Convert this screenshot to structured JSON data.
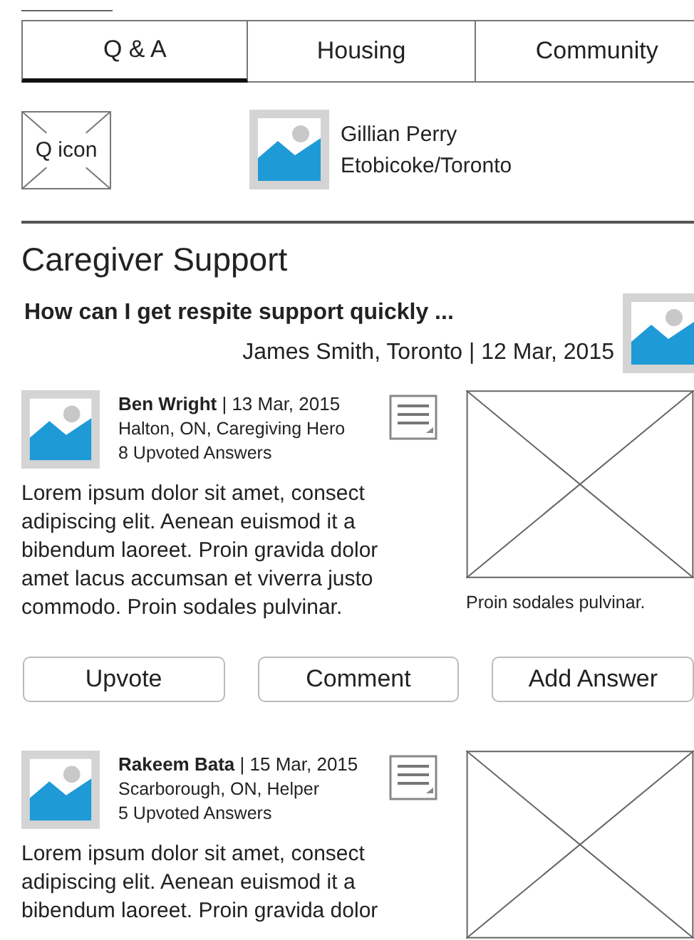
{
  "tabs": [
    {
      "label": "Q & A",
      "selected": true
    },
    {
      "label": "Housing",
      "selected": false
    },
    {
      "label": "Community",
      "selected": false
    }
  ],
  "profile": {
    "icon_label": "Q icon",
    "name": "Gillian Perry",
    "location": "Etobicoke/Toronto"
  },
  "section_title": "Caregiver Support",
  "question": {
    "title": "How can I get respite support quickly ...",
    "byline": "James Smith, Toronto | 12 Mar, 2015"
  },
  "answers": [
    {
      "author": "Ben Wright",
      "date": " | 13 Mar, 2015",
      "details": "Halton, ON, Caregiving Hero",
      "upvotes": "8 Upvoted Answers",
      "body": "Lorem ipsum dolor sit amet, consect adipiscing elit. Aenean euismod it a bibendum laoreet. Proin gravida dolor amet lacus accumsan et viverra justo commodo. Proin sodales pulvinar.",
      "caption": "Proin sodales pulvinar.",
      "buttons": [
        "Upvote",
        "Comment",
        "Add Answer"
      ]
    },
    {
      "author": "Rakeem Bata",
      "date": " | 15 Mar, 2015",
      "details": "Scarborough, ON, Helper",
      "upvotes": "5 Upvoted Answers",
      "body": "Lorem ipsum dolor sit amet, consect adipiscing elit. Aenean euismod it a bibendum laoreet. Proin gravida dolor"
    }
  ]
}
